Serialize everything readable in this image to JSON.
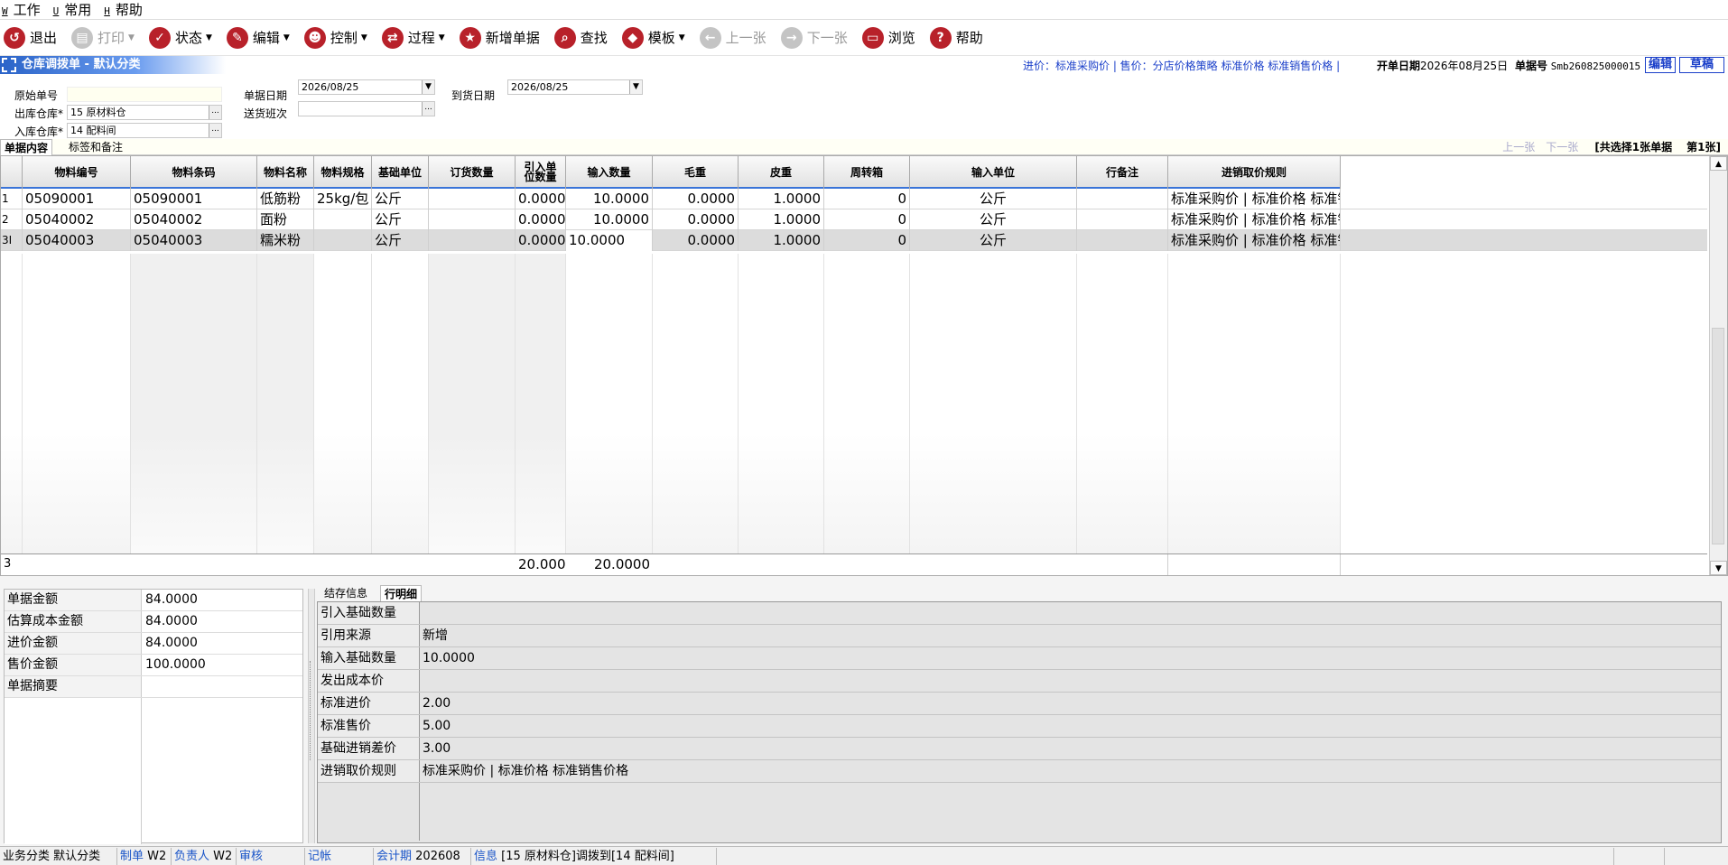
{
  "menubar": [
    {
      "mnemonic": "W",
      "label": "工作"
    },
    {
      "mnemonic": "U",
      "label": "常用"
    },
    {
      "mnemonic": "H",
      "label": "帮助"
    }
  ],
  "toolbar": {
    "exit": "退出",
    "print": "打印",
    "status": "状态",
    "edit": "编辑",
    "control": "控制",
    "process": "过程",
    "new_doc": "新增单据",
    "find": "查找",
    "template": "模板",
    "prev": "上一张",
    "next": "下一张",
    "browse": "浏览",
    "help": "帮助"
  },
  "form": {
    "title": "仓库调拨单 - 默认分类",
    "price_info": "进价：标准采购价 | 售价：分店价格策略 标准价格 标准销售价格 |",
    "open_date_label": "开单日期",
    "open_date": "2026年08月25日",
    "doc_no_label": "单据号",
    "doc_no": "Smb260825000015",
    "btn_edit": "编辑",
    "btn_draft": "草稿"
  },
  "header_fields": {
    "orig_no_label": "原始单号",
    "orig_no": "",
    "out_wh_label": "出库仓库*",
    "out_wh": "15 原材料仓",
    "in_wh_label": "入库仓库*",
    "in_wh": "14 配料间",
    "doc_date_label": "单据日期",
    "doc_date": "2026/08/25",
    "shift_label": "送货班次",
    "shift": "",
    "arrive_label": "到货日期",
    "arrive_date": "2026/08/25"
  },
  "tabs_top": {
    "content": "单据内容",
    "labels": "标签和备注"
  },
  "pager": {
    "prev": "上一张",
    "next": "下一张",
    "count": "[共选择1张单据",
    "current": "第1张]"
  },
  "grid": {
    "columns": [
      "物料编号",
      "物料条码",
      "物料名称",
      "物料规格",
      "基础单位",
      "订货数量",
      "引入单位数量",
      "输入数量",
      "毛重",
      "皮重",
      "周转箱",
      "输入单位",
      "行备注",
      "进销取价规则"
    ],
    "rows": [
      {
        "no": "1",
        "mark": "",
        "code": "05090001",
        "barcode": "05090001",
        "name": "低筋粉",
        "spec": "25kg/包",
        "unit": "公斤",
        "order_qty": "",
        "import_qty": "0.0000",
        "input_qty": "10.0000",
        "gross": "0.0000",
        "tare": "1.0000",
        "box": "0",
        "input_unit": "公斤",
        "remark": "",
        "rule": "标准采购价 | 标准价格 标准销售价格"
      },
      {
        "no": "2",
        "mark": "",
        "code": "05040002",
        "barcode": "05040002",
        "name": "面粉",
        "spec": "",
        "unit": "公斤",
        "order_qty": "",
        "import_qty": "0.0000",
        "input_qty": "10.0000",
        "gross": "0.0000",
        "tare": "1.0000",
        "box": "0",
        "input_unit": "公斤",
        "remark": "",
        "rule": "标准采购价 | 标准价格 标准销售价格"
      },
      {
        "no": "3",
        "mark": "I",
        "code": "05040003",
        "barcode": "05040003",
        "name": "糯米粉",
        "spec": "",
        "unit": "公斤",
        "order_qty": "",
        "import_qty": "0.0000",
        "input_qty": "10.0000",
        "gross": "0.0000",
        "tare": "1.0000",
        "box": "0",
        "input_unit": "公斤",
        "remark": "",
        "rule": "标准采购价 | 标准价格 标准销售价格"
      }
    ],
    "footer": {
      "count": "3",
      "import_total": "20.0000",
      "input_total": "20.0000"
    }
  },
  "summary": [
    {
      "label": "单据金额",
      "value": "84.0000"
    },
    {
      "label": "估算成本金额",
      "value": "84.0000"
    },
    {
      "label": "进价金额",
      "value": "84.0000"
    },
    {
      "label": "售价金额",
      "value": "100.0000"
    },
    {
      "label": "单据摘要",
      "value": ""
    }
  ],
  "detail_tabs": {
    "stock": "结存信息",
    "line": "行明细"
  },
  "detail": [
    {
      "label": "引入基础数量",
      "value": ""
    },
    {
      "label": "引用来源",
      "value": "新增"
    },
    {
      "label": "输入基础数量",
      "value": "10.0000"
    },
    {
      "label": "发出成本价",
      "value": ""
    },
    {
      "label": "标准进价",
      "value": "2.00"
    },
    {
      "label": "标准售价",
      "value": "5.00"
    },
    {
      "label": "基础进销差价",
      "value": "3.00"
    },
    {
      "label": "进销取价规则",
      "value": "标准采购价 | 标准价格 标准销售价格"
    }
  ],
  "statusbar": {
    "biz_label": "业务分类",
    "biz": "默认分类",
    "maker_label": "制单",
    "maker": "W2",
    "owner_label": "负责人",
    "owner": "W2",
    "audit_label": "审核",
    "post_label": "记帐",
    "period_label": "会计期",
    "period": "202608",
    "info_label": "信息",
    "info": "[15 原材料仓]调拨到[14 配料间]"
  }
}
